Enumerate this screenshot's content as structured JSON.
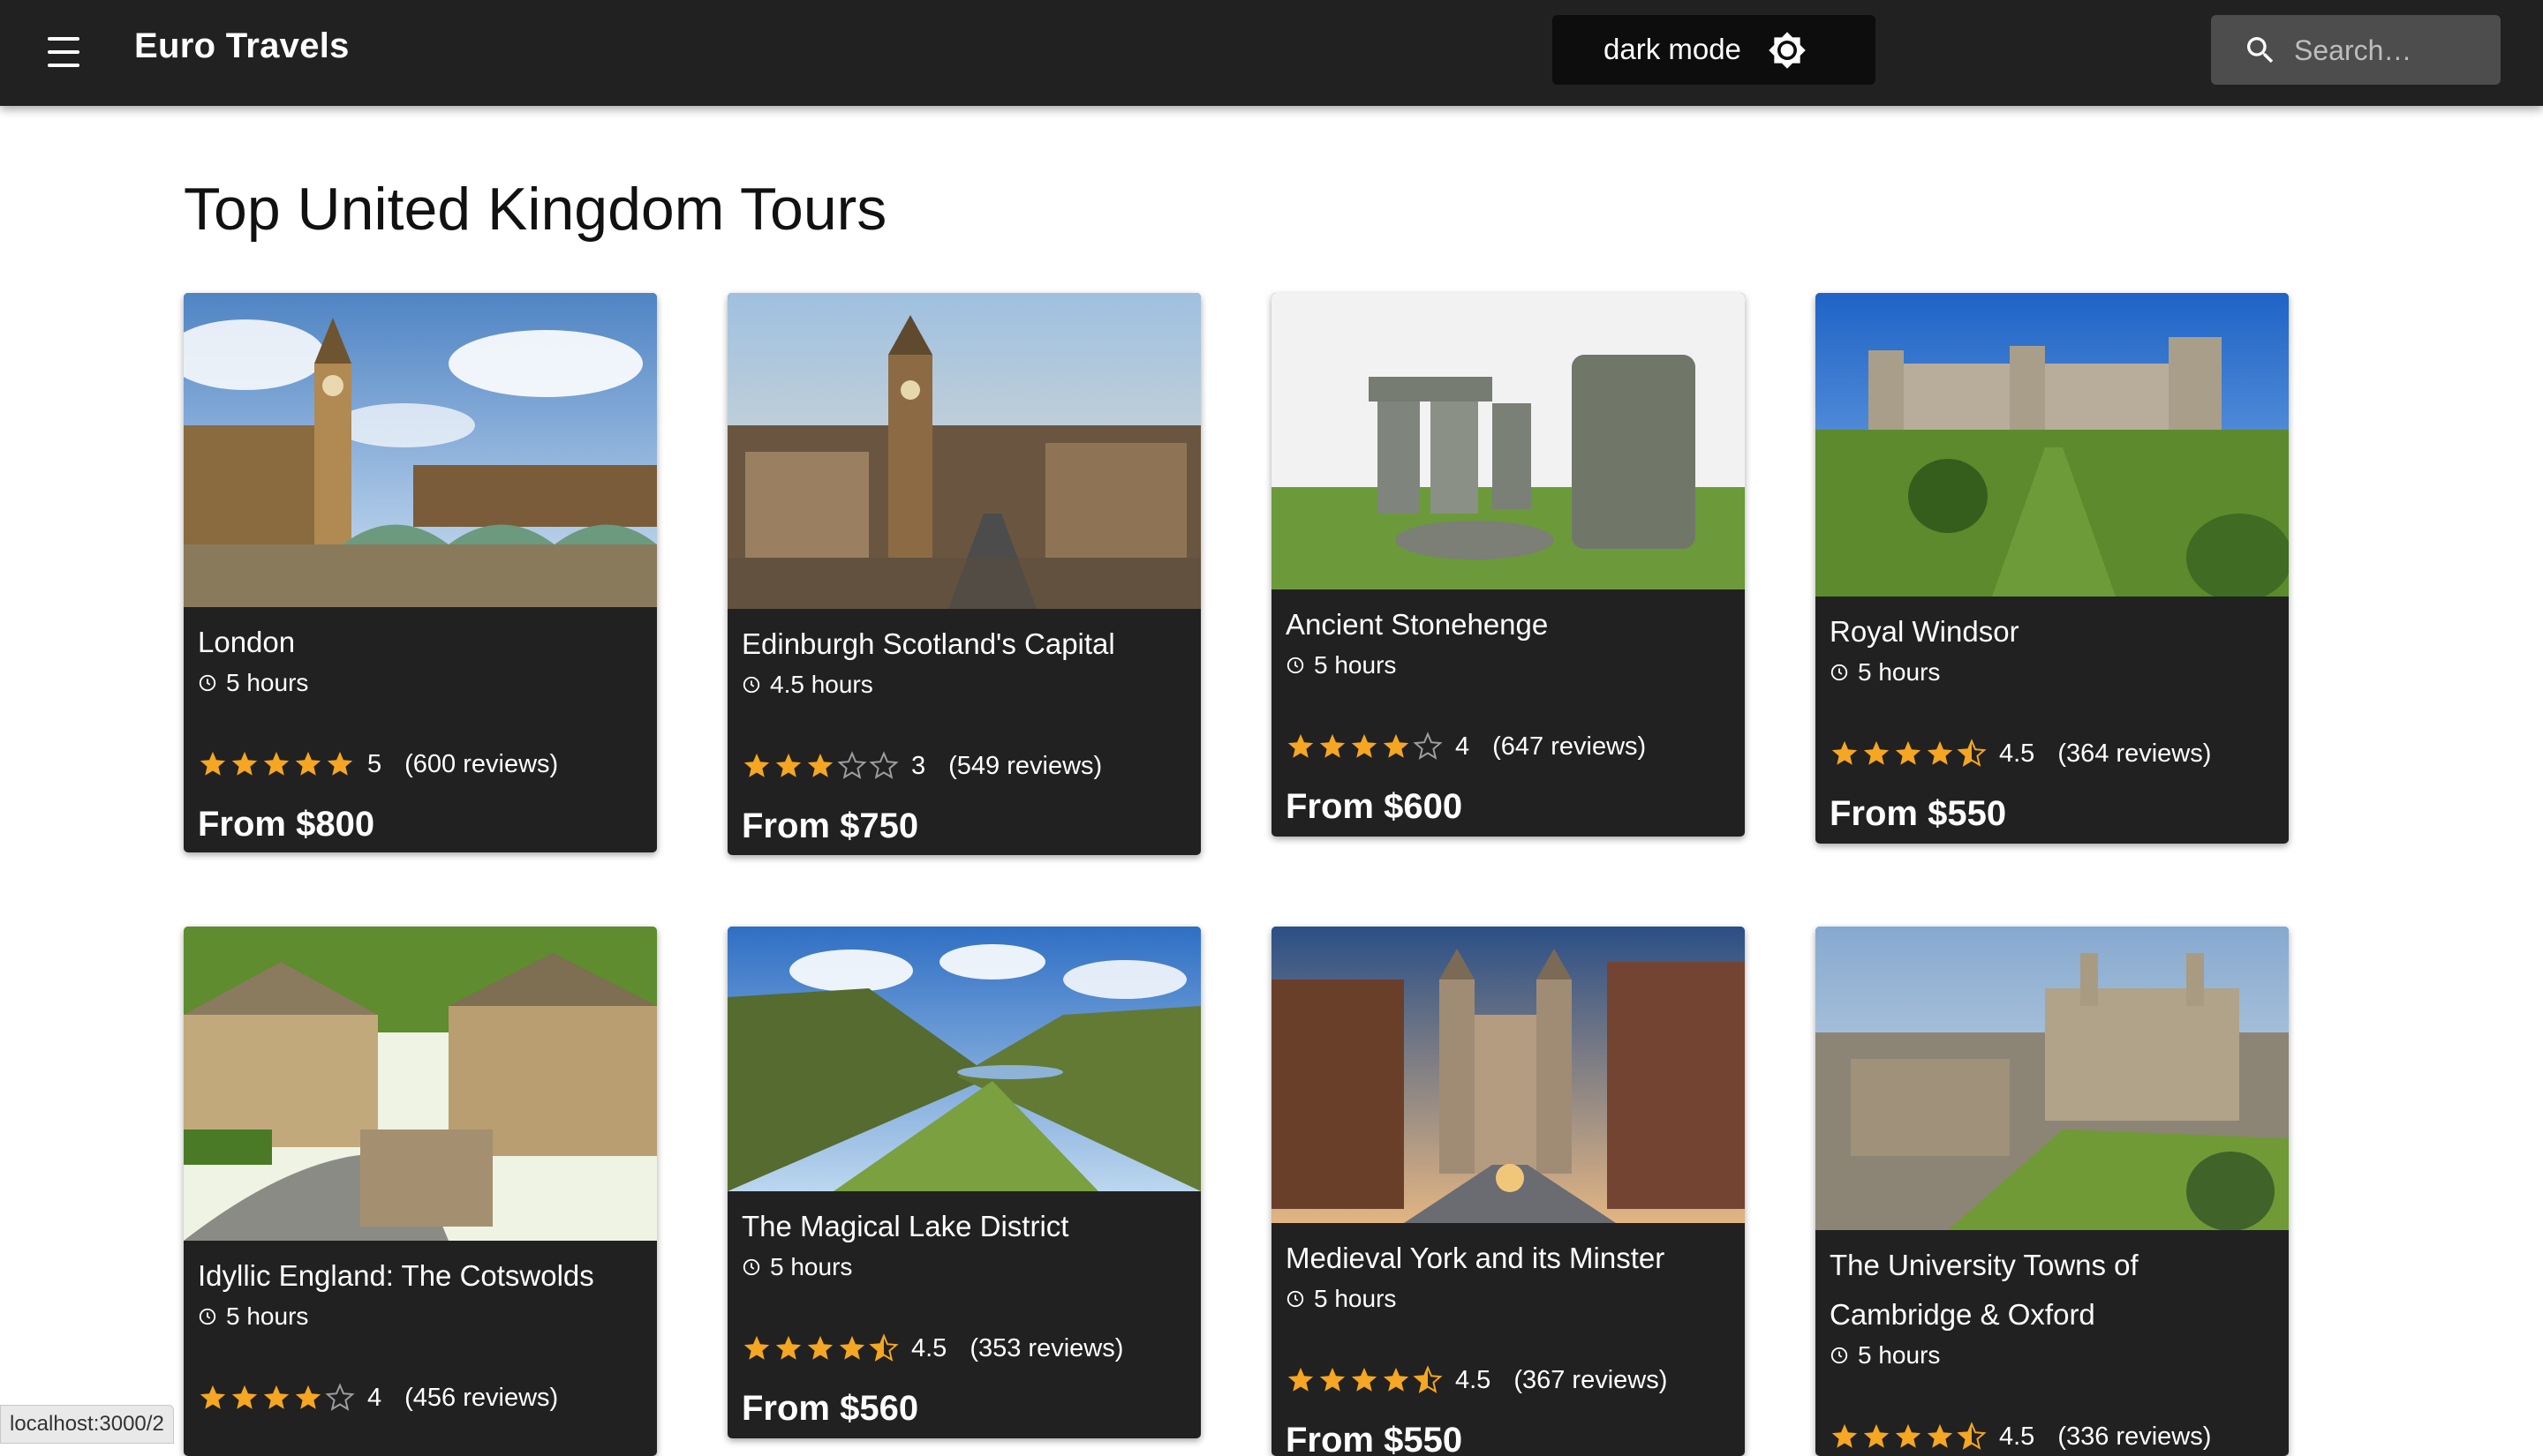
{
  "header": {
    "title": "Euro Travels",
    "mode_label": "dark mode",
    "search_placeholder": "Search…"
  },
  "page_title": "Top United Kingdom Tours",
  "colors": {
    "appbar": "#212121",
    "card": "#212121",
    "star": "#f5a623",
    "star_empty": "#9e9e9e"
  },
  "tours": [
    {
      "name": "London",
      "duration": "5 hours",
      "rating": 5,
      "rating_text": "5",
      "reviews": "(600 reviews)",
      "price": "From $800"
    },
    {
      "name": "Edinburgh Scotland's Capital",
      "duration": "4.5 hours",
      "rating": 3,
      "rating_text": "3",
      "reviews": "(549 reviews)",
      "price": "From $750"
    },
    {
      "name": "Ancient Stonehenge",
      "duration": "5 hours",
      "rating": 4,
      "rating_text": "4",
      "reviews": "(647 reviews)",
      "price": "From $600"
    },
    {
      "name": "Royal Windsor",
      "duration": "5 hours",
      "rating": 4.5,
      "rating_text": "4.5",
      "reviews": "(364 reviews)",
      "price": "From $550"
    },
    {
      "name": "Idyllic England: The Cotswolds",
      "duration": "5 hours",
      "rating": 4,
      "rating_text": "4",
      "reviews": "(456 reviews)",
      "price": ""
    },
    {
      "name": "The Magical Lake District",
      "duration": "5 hours",
      "rating": 4.5,
      "rating_text": "4.5",
      "reviews": "(353 reviews)",
      "price": "From $560"
    },
    {
      "name": "Medieval York and its Minster",
      "duration": "5 hours",
      "rating": 4.5,
      "rating_text": "4.5",
      "reviews": "(367 reviews)",
      "price": "From $550"
    },
    {
      "name": "The University Towns of Cambridge & Oxford",
      "duration": "5 hours",
      "rating": 4.5,
      "rating_text": "4.5",
      "reviews": "(336 reviews)",
      "price": ""
    }
  ],
  "status_url": "localhost:3000/2"
}
